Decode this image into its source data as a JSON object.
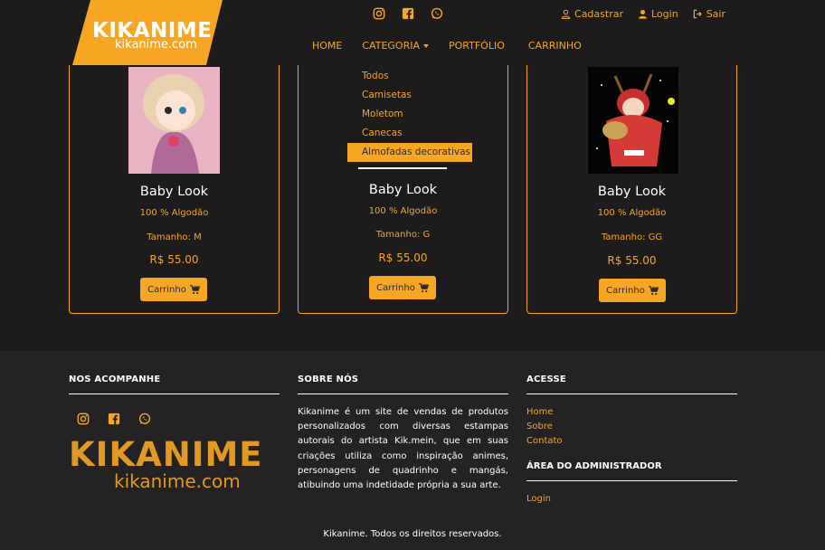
{
  "brand": {
    "name": "KIKANIME",
    "domain": "kikanime.com"
  },
  "social_icons": [
    "instagram-icon",
    "facebook-icon",
    "whatsapp-icon"
  ],
  "auth": {
    "signup": "Cadastrar",
    "login": "Login",
    "logout": "Sair"
  },
  "nav": {
    "home": "HOME",
    "category": "CATEGORIA",
    "portfolio": "PORTFÓLIO",
    "cart": "CARRINHO"
  },
  "dropdown": {
    "items": [
      "Todos",
      "Camisetas",
      "Moletom",
      "Canecas",
      "Almofadas decorativas"
    ],
    "active": "Almofadas decorativas"
  },
  "products": [
    {
      "title": "Baby Look",
      "material": "100 % Algodão",
      "size": "Tamanho: M",
      "price": "R$ 55.00",
      "button": "Carrinho"
    },
    {
      "title": "Baby Look",
      "material": "100 % Algodão",
      "size": "Tamanho: G",
      "price": "R$ 55.00",
      "button": "Carrinho"
    },
    {
      "title": "Baby Look",
      "material": "100 % Algodão",
      "size": "Tamanho: GG",
      "price": "R$ 55.00",
      "button": "Carrinho"
    }
  ],
  "footer": {
    "follow_title": "NOS ACOMPANHE",
    "about_title": "SOBRE NÓS",
    "about_text": "Kikanime é um site de vendas de produtos personalizados com diversas estampas autorais do artista Kik.mein, que em suas criações utiliza como inspiração animes, personagens de quadrinho e mangás, atibuindo uma indetidade própria a sua arte.",
    "access_title": "ACESSE",
    "links": {
      "home": "Home",
      "about": "Sobre",
      "contact": "Contato"
    },
    "admin_title": "ÁREA DO ADMINISTRADOR",
    "admin_login": "Login",
    "copyright": "Kikanime. Todos os direitos reservados."
  },
  "colors": {
    "accent": "#f6a623",
    "background": "#1d1b1c",
    "footer": "#242223"
  }
}
